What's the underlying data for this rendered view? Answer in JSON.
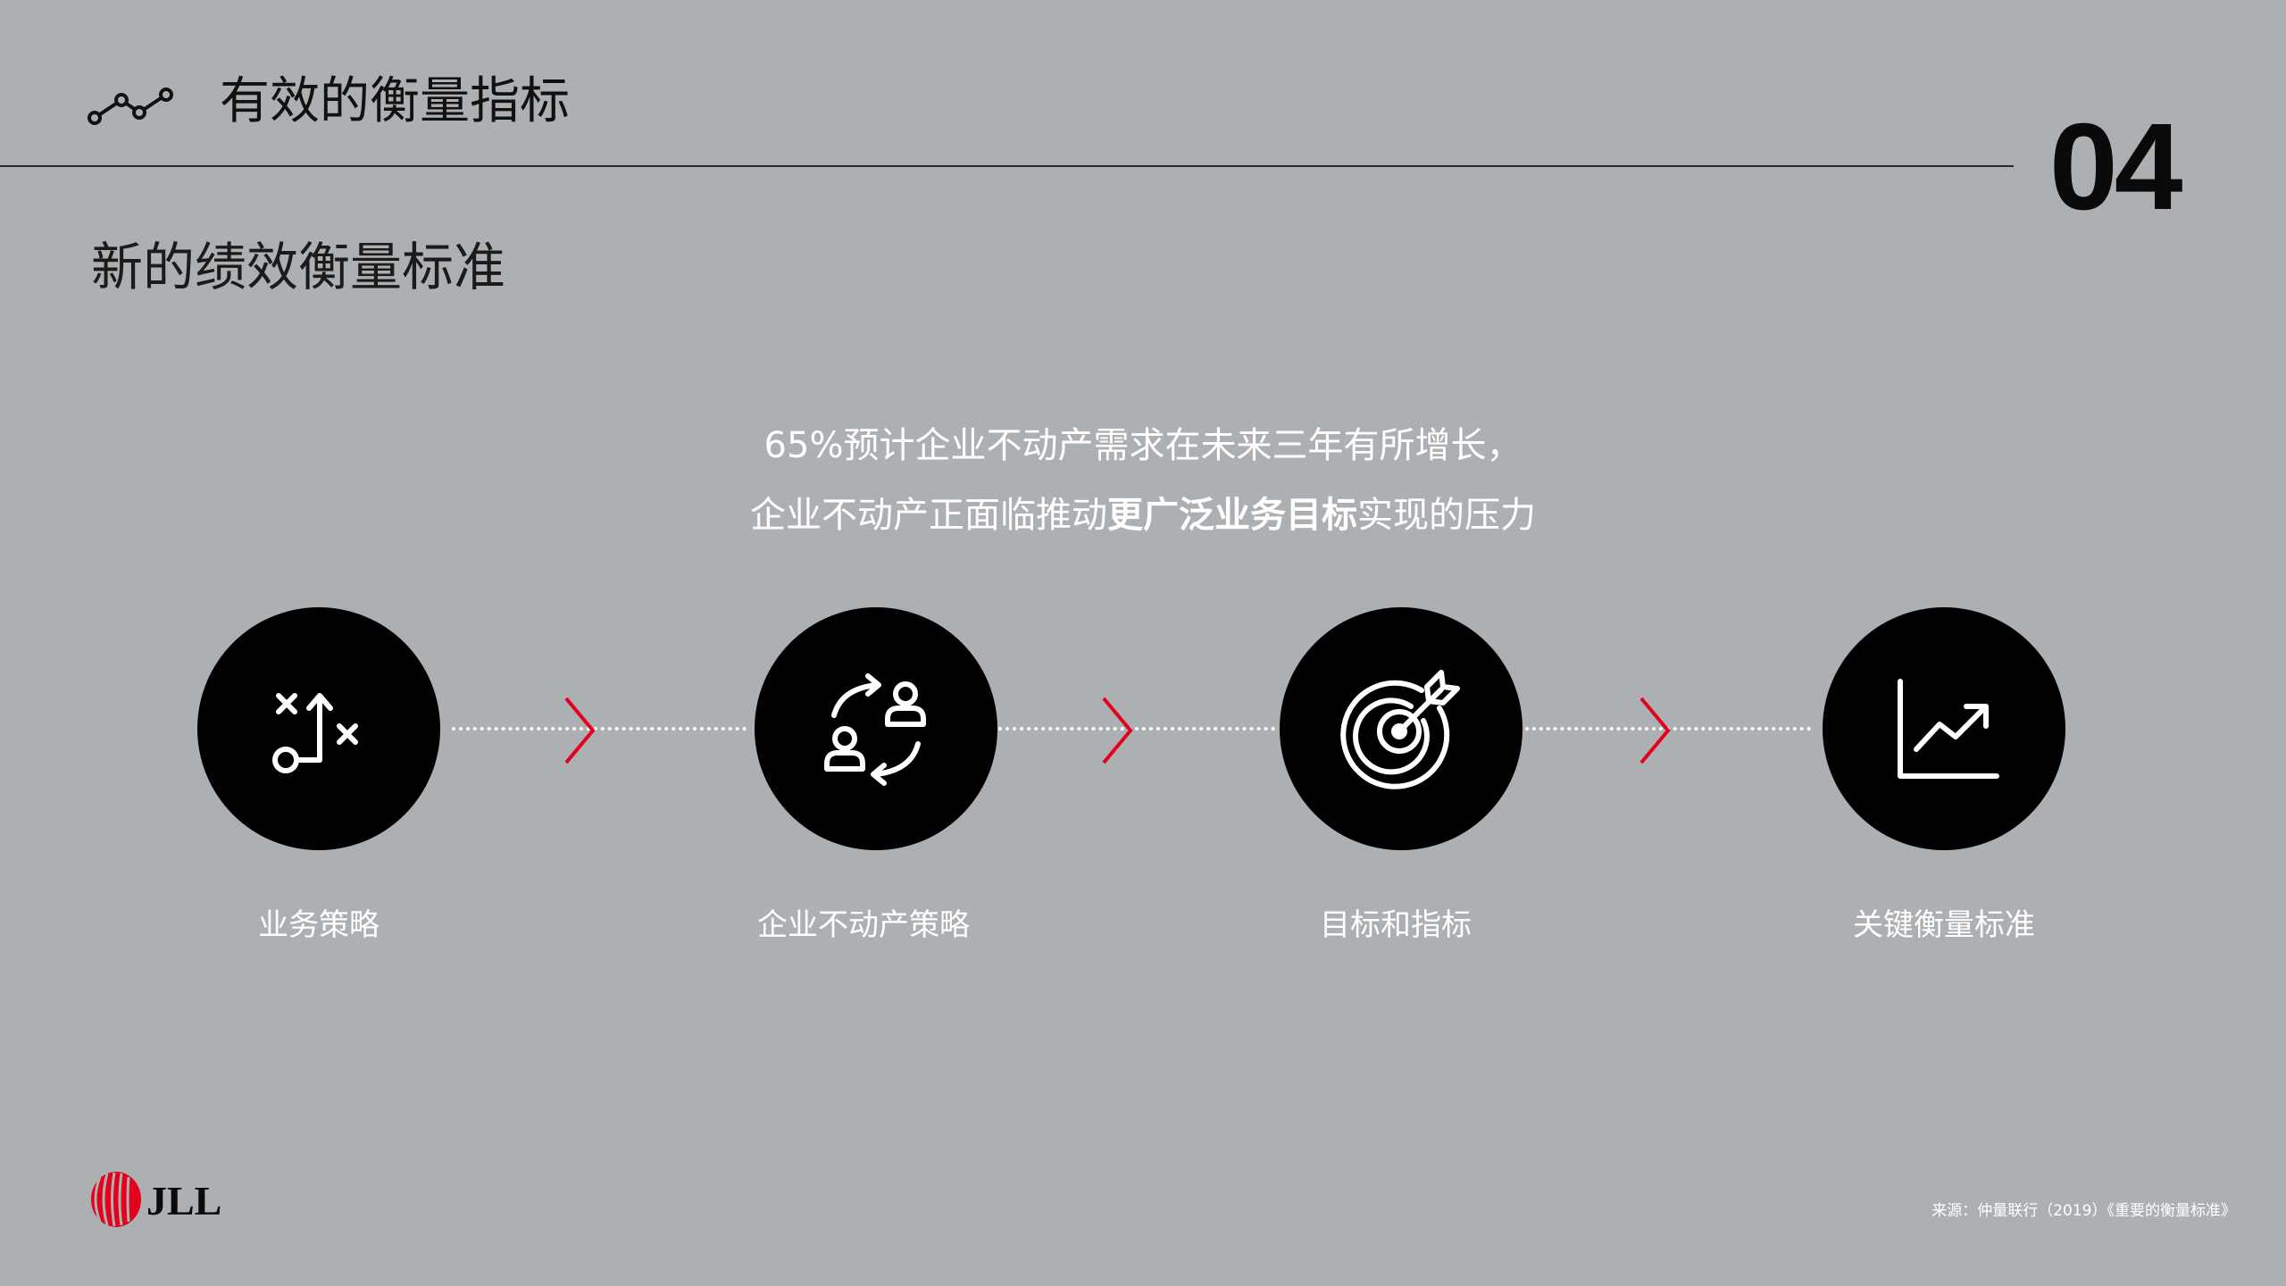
{
  "header": {
    "icon": "trend-line-icon",
    "title": "有效的衡量指标",
    "page_number": "04"
  },
  "subtitle": "新的绩效衡量标准",
  "statement": {
    "line1": "65%预计企业不动产需求在未来三年有所增长，",
    "line2_prefix": "企业不动产正面临推动",
    "line2_emphasis": "更广泛业务目标",
    "line2_suffix": "实现的压力"
  },
  "steps": [
    {
      "icon": "strategy-play-icon",
      "label": "业务策略"
    },
    {
      "icon": "people-exchange-icon",
      "label": "企业不动产策略"
    },
    {
      "icon": "target-arrow-icon",
      "label": "目标和指标"
    },
    {
      "icon": "growth-chart-icon",
      "label": "关键衡量标准"
    }
  ],
  "connector_icon": "chevron-right-icon",
  "colors": {
    "background": "#adb0b3",
    "circle": "#000000",
    "accent_red": "#e3001b",
    "text_light": "#ffffff",
    "text_dark": "#111111"
  },
  "footer": {
    "logo": "JLL",
    "source": "来源：仲量联行（2019）《重要的衡量标准》"
  }
}
